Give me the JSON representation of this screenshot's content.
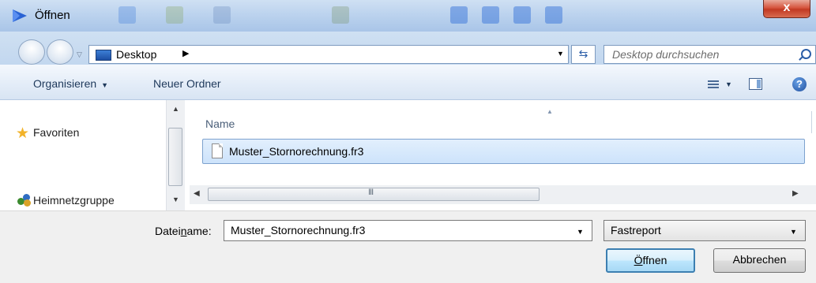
{
  "window": {
    "title": "Öffnen",
    "close_label": "x"
  },
  "address": {
    "location": "Desktop",
    "search_placeholder": "Desktop durchsuchen"
  },
  "toolbar": {
    "organize_label": "Organisieren",
    "new_folder_label": "Neuer Ordner"
  },
  "sidebar": {
    "items": [
      {
        "label": "Favoriten",
        "icon": "star-icon"
      },
      {
        "label": "Heimnetzgruppe",
        "icon": "homegroup-icon"
      }
    ]
  },
  "filelist": {
    "column_name": "Name",
    "files": [
      {
        "name": "Muster_Stornorechnung.fr3",
        "icon": "document-icon",
        "selected": true
      }
    ]
  },
  "footer": {
    "filename_label_pre": "Datei",
    "filename_label_ul": "n",
    "filename_label_post": "ame:",
    "filename_value": "Muster_Stornorechnung.fr3",
    "filetype_value": "Fastreport",
    "open_ul": "Ö",
    "open_rest": "ffnen",
    "cancel_label": "Abbrechen"
  },
  "colors": {
    "accent": "#3c7fb1",
    "selection": "#cde3fb",
    "close": "#c23a23"
  }
}
